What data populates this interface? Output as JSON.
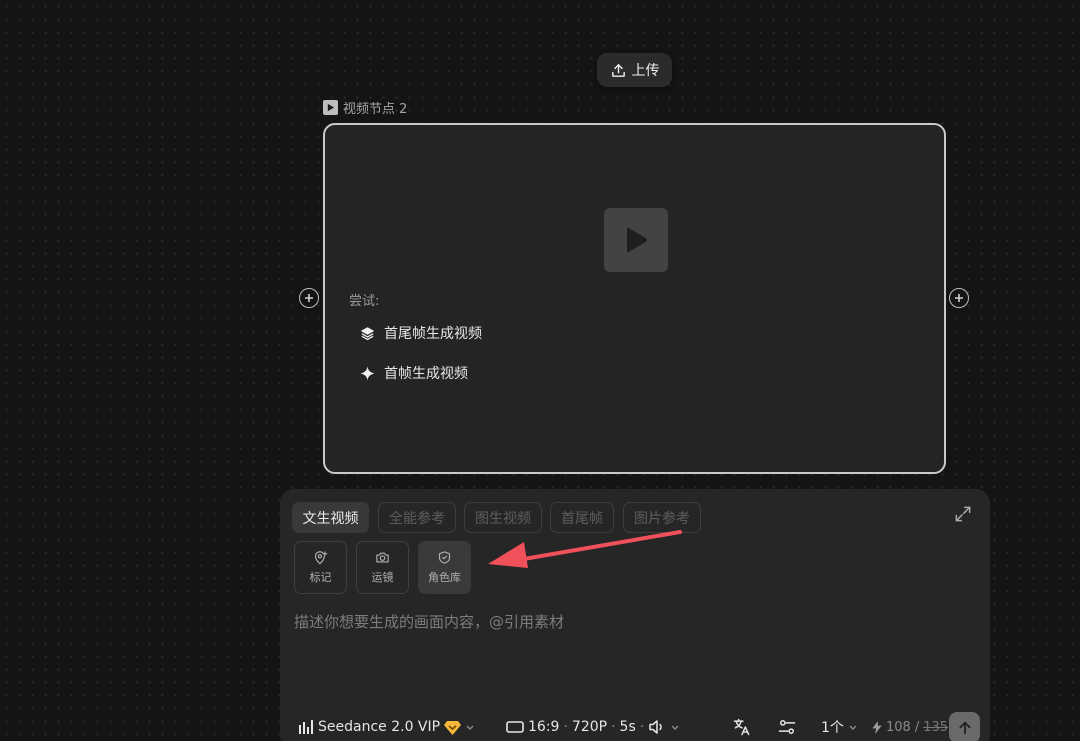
{
  "upload": {
    "label": "上传",
    "icon": "upload-icon"
  },
  "node": {
    "title": "视频节点 2",
    "icon": "video-node-icon",
    "try_label": "尝试:",
    "suggestions": [
      {
        "label": "首尾帧生成视频",
        "icon": "layers-icon"
      },
      {
        "label": "首帧生成视频",
        "icon": "sparkle-icon"
      }
    ]
  },
  "panel": {
    "tabs": [
      {
        "label": "文生视频",
        "active": true
      },
      {
        "label": "全能参考",
        "active": false
      },
      {
        "label": "图生视频",
        "active": false
      },
      {
        "label": "首尾帧",
        "active": false
      },
      {
        "label": "图片参考",
        "active": false
      }
    ],
    "tools": [
      {
        "label": "标记",
        "icon": "map-pin-plus-icon"
      },
      {
        "label": "运镜",
        "icon": "camera-icon"
      },
      {
        "label": "角色库",
        "icon": "shield-icon"
      }
    ],
    "prompt_placeholder": "描述你想要生成的画面内容，@引用素材",
    "toolbar": {
      "model": "Seedance 2.0 VIP",
      "ratio": "16:9",
      "resolution": "720P",
      "duration": "5s",
      "separator": "·",
      "count": "1个",
      "credits_current": "108",
      "credits_slash": "/",
      "credits_original": "135"
    }
  },
  "colors": {
    "background": "#141414",
    "card": "#242424",
    "panel": "#262626",
    "vip_badge": "#f5b83a",
    "annotation_arrow": "#f0505a"
  }
}
